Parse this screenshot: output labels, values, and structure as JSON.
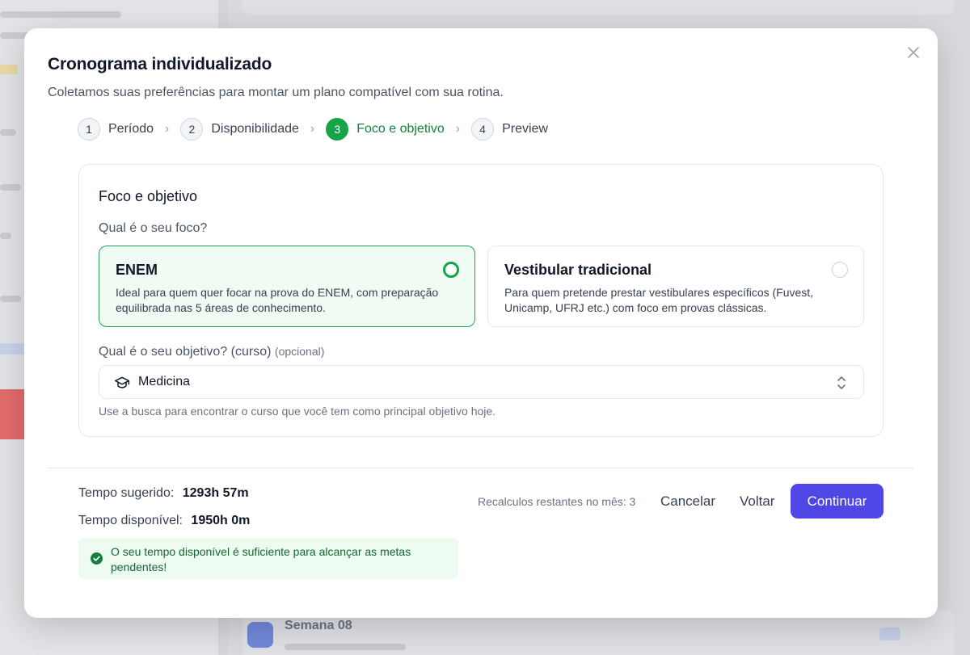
{
  "modal": {
    "title": "Cronograma individualizado",
    "subtitle": "Coletamos suas preferências para montar um plano compatível com sua rotina.",
    "close_icon": "close-icon"
  },
  "stepper": {
    "steps": [
      {
        "number": "1",
        "label": "Período",
        "active": false
      },
      {
        "number": "2",
        "label": "Disponibilidade",
        "active": false
      },
      {
        "number": "3",
        "label": "Foco e objetivo",
        "active": true
      },
      {
        "number": "4",
        "label": "Preview",
        "active": false
      }
    ],
    "separator": "›"
  },
  "card": {
    "title": "Foco e objetivo",
    "focus_question": "Qual é o seu foco?",
    "options": [
      {
        "title": "ENEM",
        "description": "Ideal para quem quer focar na prova do ENEM, com preparação equilibrada nas 5 áreas de conhecimento.",
        "selected": true
      },
      {
        "title": "Vestibular tradicional",
        "description": "Para quem pretende prestar vestibulares específicos (Fuvest, Unicamp, UFRJ etc.) com foco em provas clássicas.",
        "selected": false
      }
    ],
    "goal_question": "Qual é o seu objetivo? (curso)",
    "goal_optional": "(opcional)",
    "goal_value": "Medicina",
    "goal_icon": "graduation-cap-icon",
    "help_text": "Use a busca para encontrar o curso que você tem como principal objetivo hoje."
  },
  "footer": {
    "suggested_label": "Tempo sugerido:",
    "suggested_value": "1293h 57m",
    "available_label": "Tempo disponível:",
    "available_value": "1950h 0m",
    "alert_text": "O seu tempo disponível é suficiente para alcançar as metas pendentes!",
    "recalc_text": "Recalculos restantes no mês: 3",
    "cancel_label": "Cancelar",
    "back_label": "Voltar",
    "continue_label": "Continuar"
  },
  "background": {
    "week_label": "Semana 08"
  },
  "colors": {
    "accent": "#4f46e5",
    "success": "#16a34a",
    "success_bg": "#f0fbf4"
  }
}
